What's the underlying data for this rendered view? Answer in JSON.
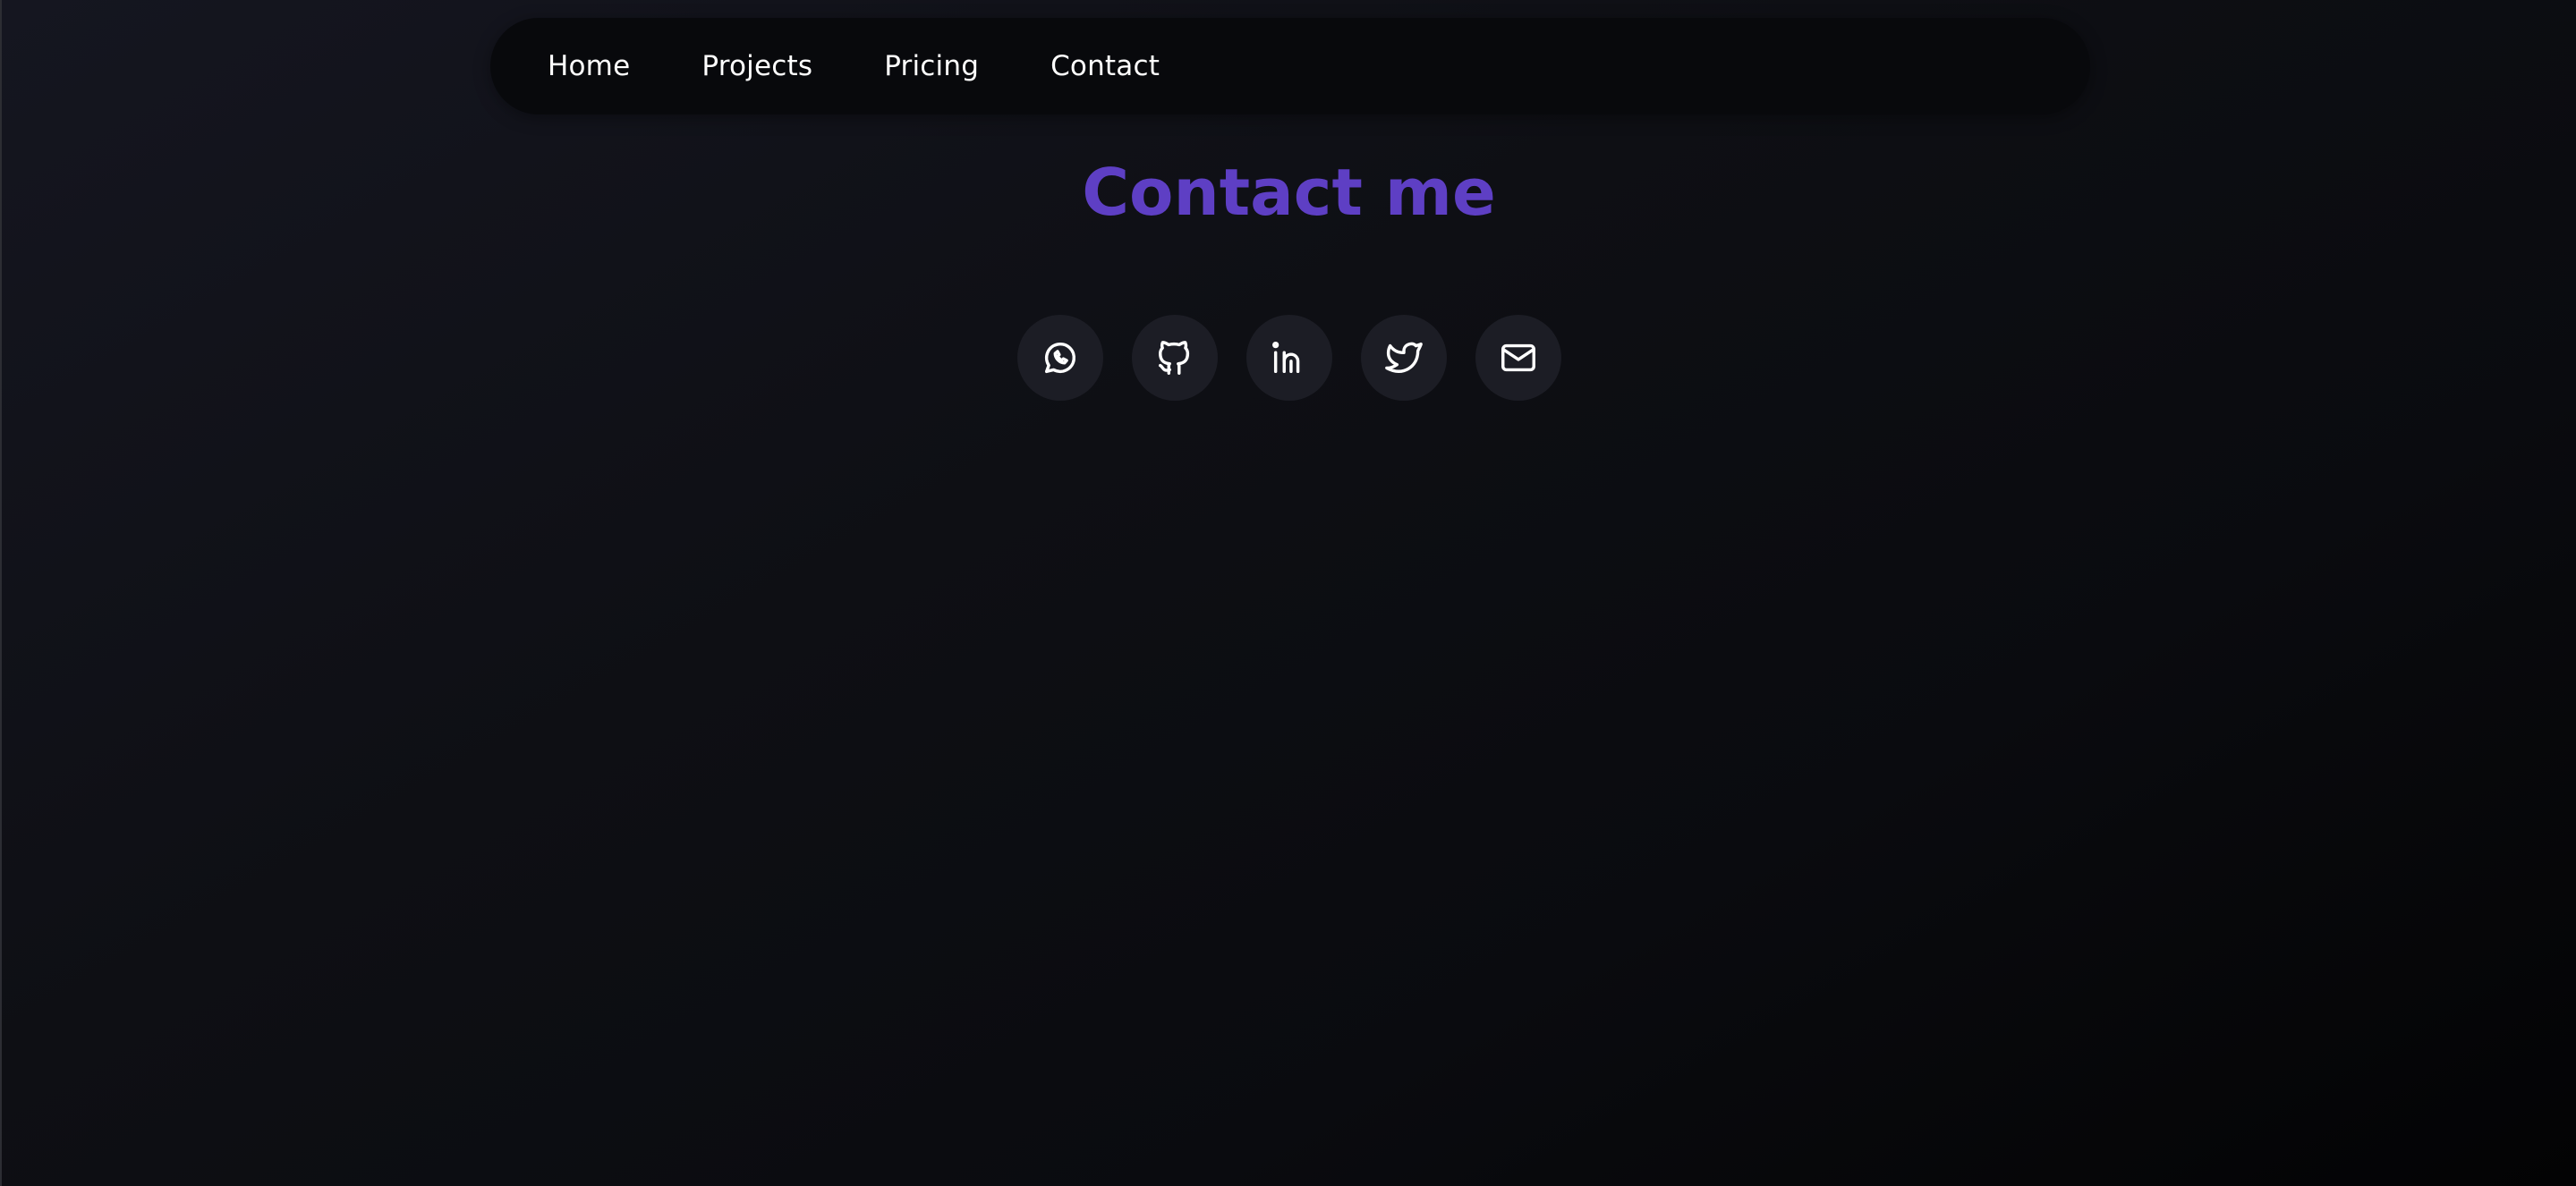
{
  "nav": {
    "items": [
      {
        "label": "Home"
      },
      {
        "label": "Projects"
      },
      {
        "label": "Pricing"
      },
      {
        "label": "Contact"
      }
    ]
  },
  "main": {
    "title": "Contact me",
    "title_color": "#5e3fc4"
  },
  "socials": [
    {
      "icon": "whatsapp-icon"
    },
    {
      "icon": "github-icon"
    },
    {
      "icon": "linkedin-icon"
    },
    {
      "icon": "twitter-icon"
    },
    {
      "icon": "mail-icon"
    }
  ]
}
